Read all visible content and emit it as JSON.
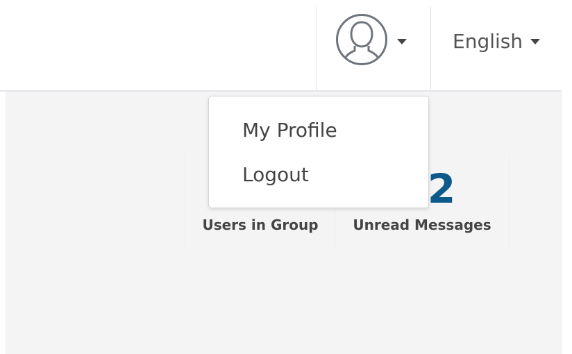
{
  "header": {
    "user_menu": {
      "icon": "user-avatar-icon",
      "caret_icon": "caret-down-icon"
    },
    "language": {
      "label": "English",
      "caret_icon": "caret-down-icon"
    }
  },
  "dropdown": {
    "items": [
      {
        "label": "My Profile"
      },
      {
        "label": "Logout"
      }
    ]
  },
  "stats": [
    {
      "value": "",
      "label": "Users in Group"
    },
    {
      "value": "2",
      "label": "Unread Messages"
    }
  ],
  "colors": {
    "stat_value": "#0b5a8a",
    "content_bg": "#f4f4f4",
    "divider": "#e2e2e2",
    "text": "#444444"
  }
}
